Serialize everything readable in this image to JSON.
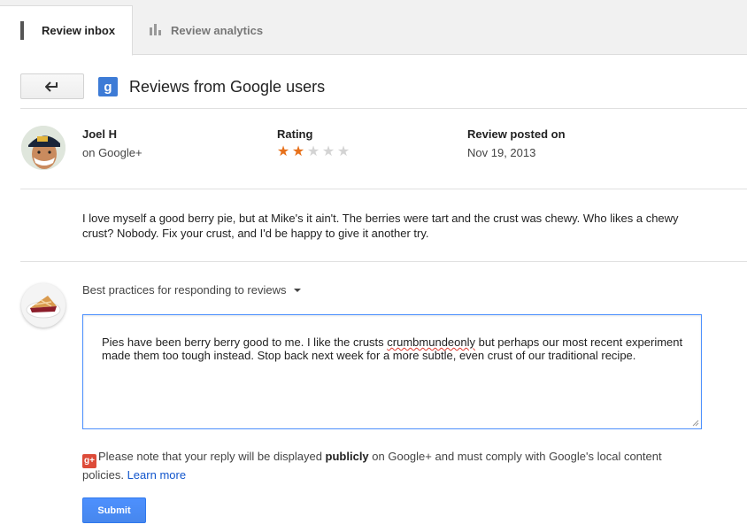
{
  "tabs": [
    {
      "label": "Review inbox",
      "icon": "envelope-icon",
      "active": true
    },
    {
      "label": "Review analytics",
      "icon": "bar-chart-icon",
      "active": false
    }
  ],
  "header": {
    "back_icon": "back-arrow-icon",
    "badge_icon": "google-plus-icon",
    "badge_text": "g",
    "title": "Reviews from Google users"
  },
  "review": {
    "reviewer_name": "Joel H",
    "reviewer_source": "on Google+",
    "rating_label": "Rating",
    "rating": 2,
    "rating_max": 5,
    "date_label": "Review posted on",
    "date": "Nov 19, 2013",
    "text": "I love myself a good berry pie, but at Mike's it ain't. The berries were tart and the crust was chewy. Who likes a chewy crust? Nobody. Fix your crust, and I'd be happy to give it another try."
  },
  "reply": {
    "best_practices_label": "Best practices for responding to reviews",
    "text_before": "Pies have been berry berry good to me. I like the crusts ",
    "misspelled": "crumbmundeonly",
    "text_after": " but perhaps our most recent experiment made them too tough instead. Stop back next week for a more subtle, even crust of our traditional recipe.",
    "notice_icon_text": "g+",
    "notice_before": "Please note that your reply will be displayed ",
    "notice_bold": "publicly",
    "notice_after": " on Google+ and must comply with Google's local content policies. ",
    "learn_more": "Learn more",
    "submit_label": "Submit"
  },
  "colors": {
    "accent_blue": "#4d90fe",
    "star_on": "#e7711b",
    "star_off": "#d4d4d4",
    "link": "#1155cc",
    "gplus_red": "#dd4b39"
  }
}
